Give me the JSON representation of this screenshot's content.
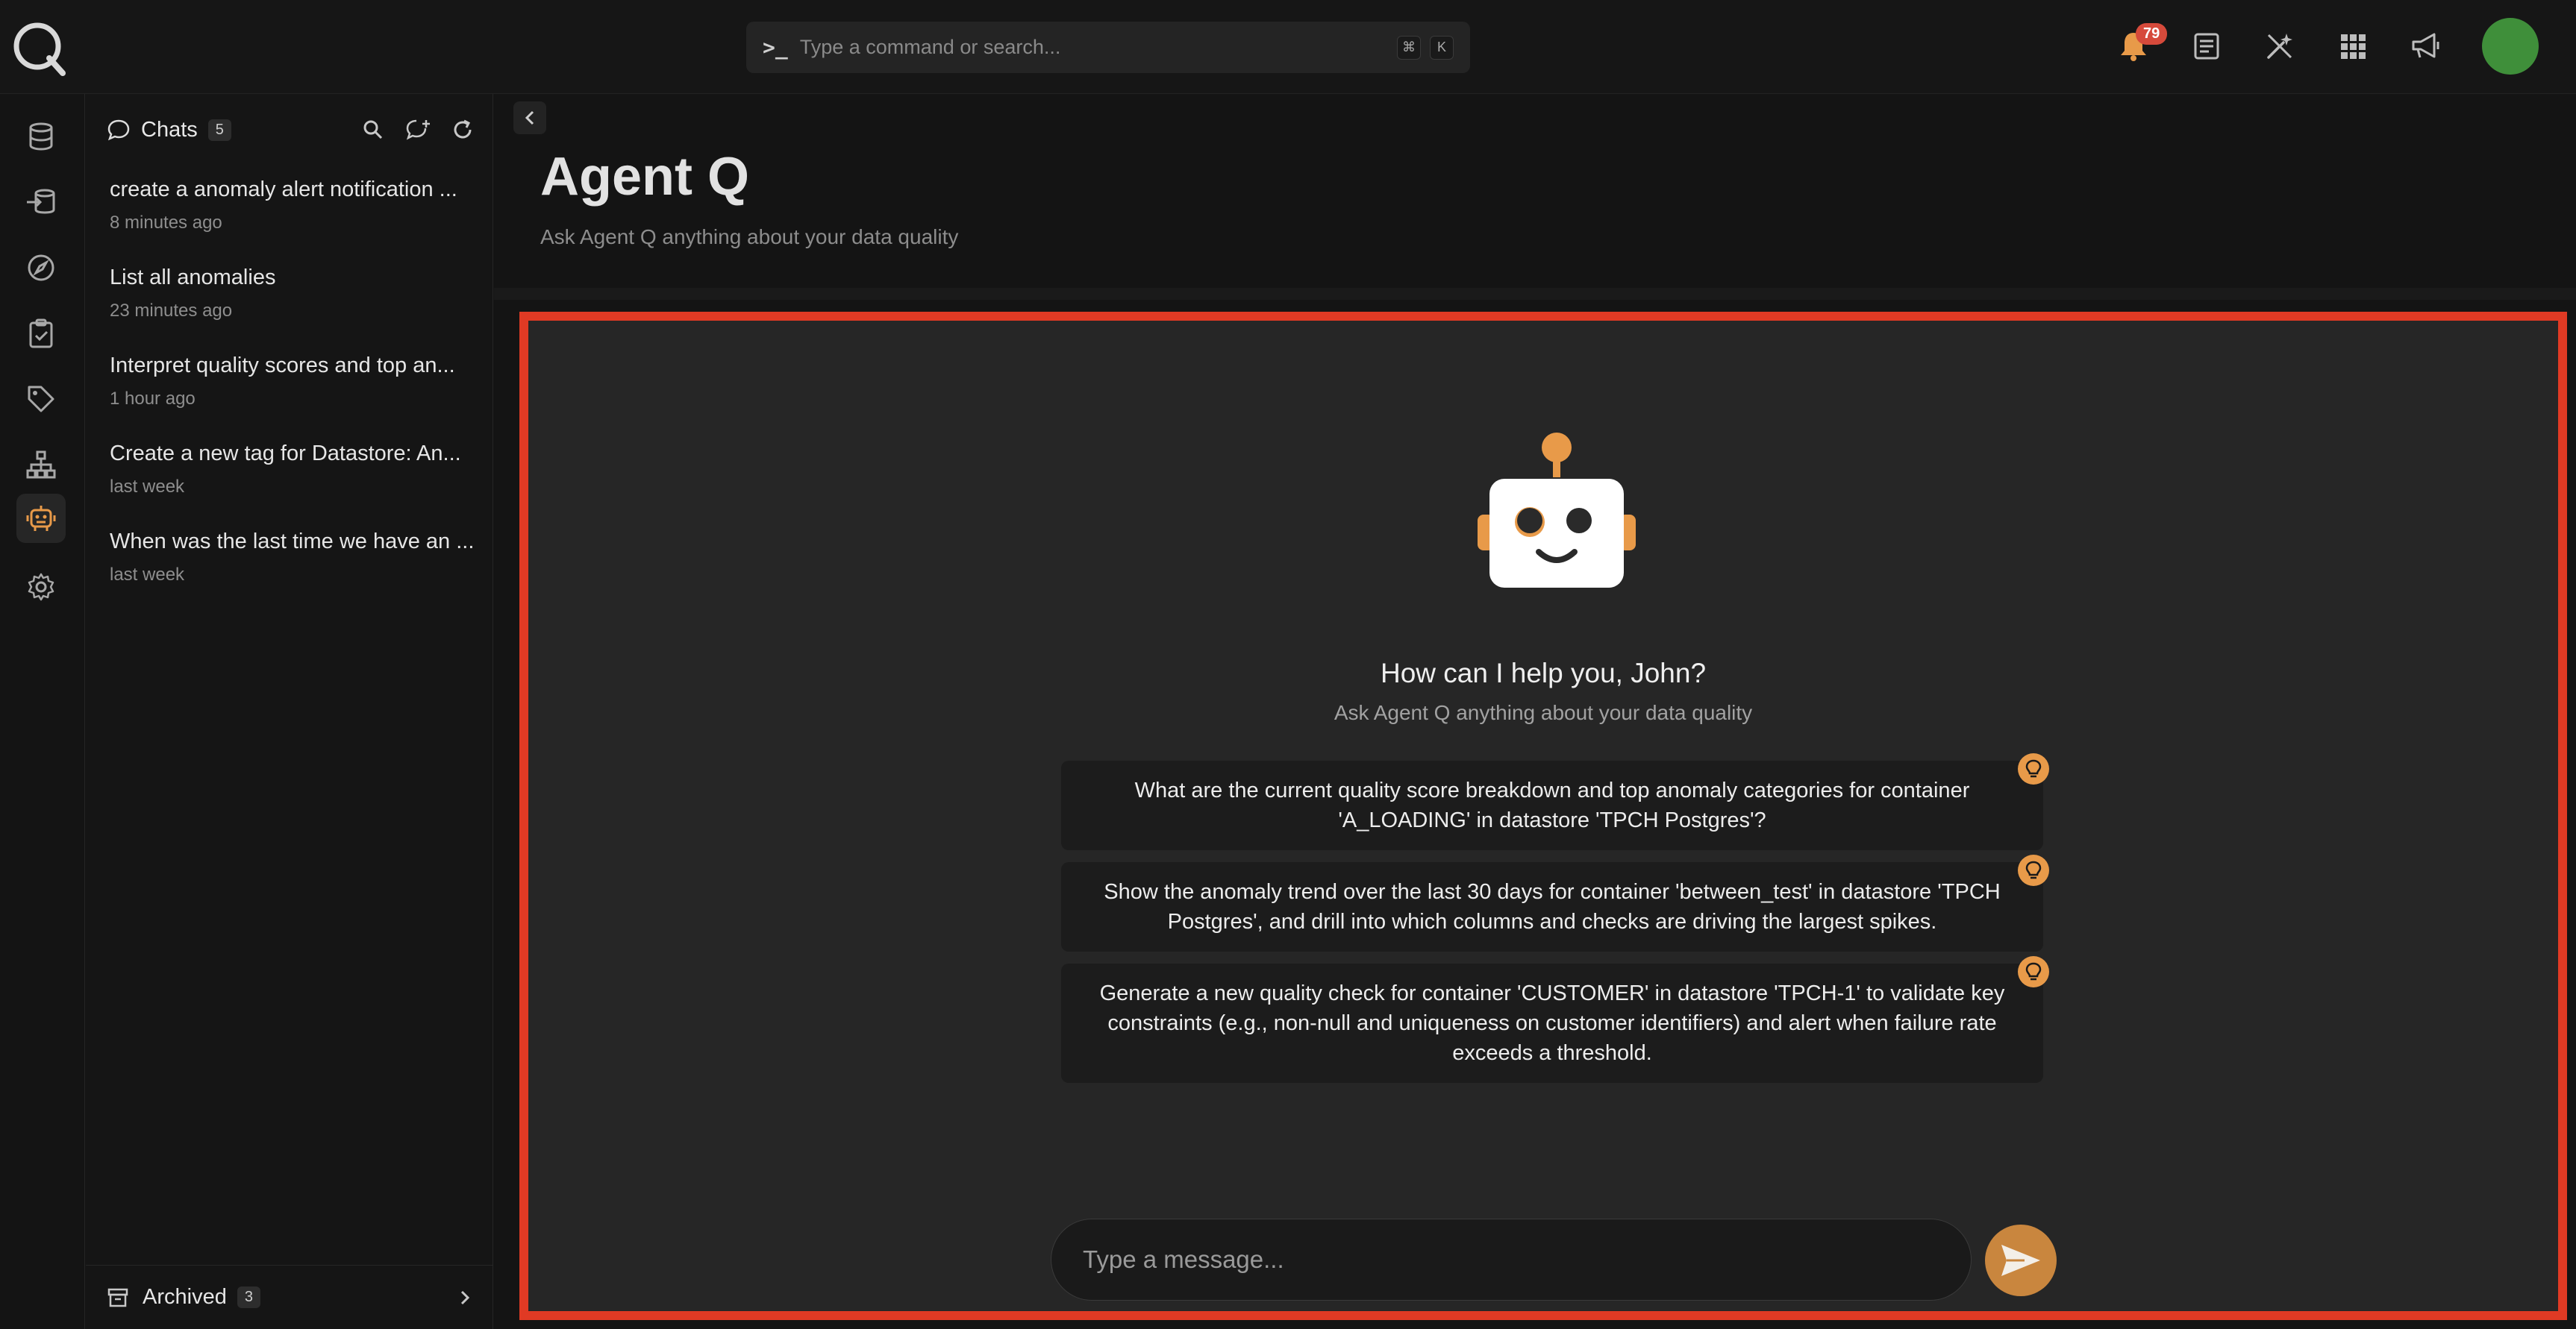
{
  "topbar": {
    "command_placeholder": "Type a command or search...",
    "shortcut_keys": [
      "⌘",
      "K"
    ],
    "notifications_count": "79",
    "avatar_color": "#3f8f3a"
  },
  "rail": {
    "items": [
      "database-icon",
      "ingest-icon",
      "explore-icon",
      "checks-icon",
      "tags-icon",
      "hierarchy-icon",
      "agent-robot-icon",
      "settings-icon"
    ],
    "active": "agent-robot-icon"
  },
  "sidebar": {
    "title": "Chats",
    "count": "5",
    "chats": [
      {
        "title": "create a anomaly alert notification ...",
        "time": "8 minutes ago"
      },
      {
        "title": "List all anomalies",
        "time": "23 minutes ago"
      },
      {
        "title": "Interpret quality scores and top an...",
        "time": "1 hour ago"
      },
      {
        "title": "Create a new tag for Datastore: An...",
        "time": "last week"
      },
      {
        "title": "When was the last time we have an ...",
        "time": "last week"
      }
    ],
    "archived_label": "Archived",
    "archived_count": "3"
  },
  "main": {
    "title": "Agent Q",
    "subtitle": "Ask Agent Q anything about your data quality"
  },
  "panel": {
    "greeting": "How can I help you, John?",
    "greeting_sub": "Ask Agent Q anything about your data quality",
    "suggestions": [
      "What are the current quality score breakdown and top anomaly categories for container 'A_LOADING' in datastore 'TPCH Postgres'?",
      "Show the anomaly trend over the last 30 days for container 'between_test' in datastore 'TPCH Postgres', and drill into which columns and checks are driving the largest spikes.",
      "Generate a new quality check for container 'CUSTOMER' in datastore 'TPCH-1' to validate key constraints (e.g., non-null and uniqueness on customer identifiers) and alert when failure rate exceeds a threshold."
    ],
    "input_placeholder": "Type a message...",
    "accent_color": "#e89a49",
    "highlight_border_color": "#e03a24"
  }
}
